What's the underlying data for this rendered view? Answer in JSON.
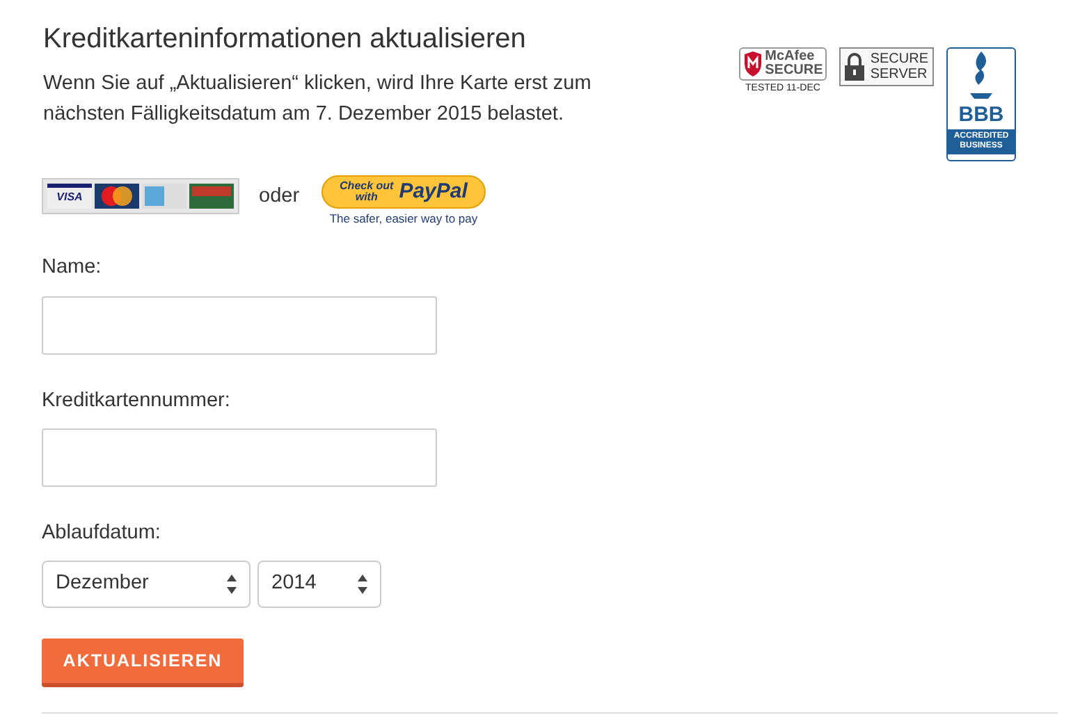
{
  "title": "Kreditkarteninformationen aktualisieren",
  "intro": "Wenn Sie auf „Aktualisieren“ klicken, wird Ihre Karte erst zum nächsten Fälligkeitsdatum am 7. Dezember 2015 belastet.",
  "badges": {
    "mcafee": {
      "brand": "McAfee",
      "label": "SECURE",
      "tested": "TESTED 11-DEC"
    },
    "secure_server": "SECURE\nSERVER",
    "bbb": {
      "logo": "BBB",
      "label": "ACCREDITED BUSINESS"
    }
  },
  "payment": {
    "card_visa": "VISA",
    "or": "oder",
    "paypal_button": {
      "line1": "Check out",
      "line2": "with",
      "brand": "PayPal"
    },
    "paypal_tagline": "The safer, easier way to pay"
  },
  "fields": [
    {
      "label": "Name:"
    },
    {
      "label": "Kreditkartennummer:"
    }
  ],
  "expiry": {
    "label": "Ablaufdatum:",
    "month": "Dezember",
    "year": "2014"
  },
  "submit": "AKTUALISIEREN"
}
